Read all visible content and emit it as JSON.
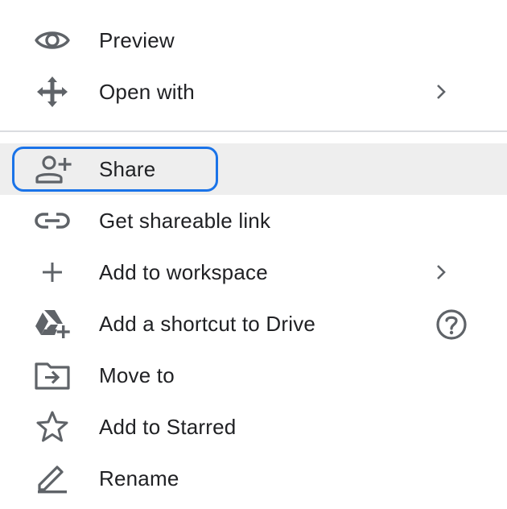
{
  "menu": {
    "items": [
      {
        "label": "Preview",
        "icon": "eye-icon"
      },
      {
        "label": "Open with",
        "icon": "move-arrows-icon",
        "submenu": true
      },
      {
        "label": "Share",
        "icon": "person-add-icon",
        "hovered": true,
        "focused": true
      },
      {
        "label": "Get shareable link",
        "icon": "link-icon"
      },
      {
        "label": "Add to workspace",
        "icon": "plus-icon",
        "submenu": true
      },
      {
        "label": "Add a shortcut to Drive",
        "icon": "drive-add-icon",
        "help": true
      },
      {
        "label": "Move to",
        "icon": "folder-move-icon"
      },
      {
        "label": "Add to Starred",
        "icon": "star-icon"
      },
      {
        "label": "Rename",
        "icon": "pencil-icon"
      }
    ]
  },
  "colors": {
    "text": "#202124",
    "icon": "#5f6368",
    "hover_bg": "#eeeeee",
    "focus_ring": "#1a73e8",
    "divider": "#dadce0"
  }
}
